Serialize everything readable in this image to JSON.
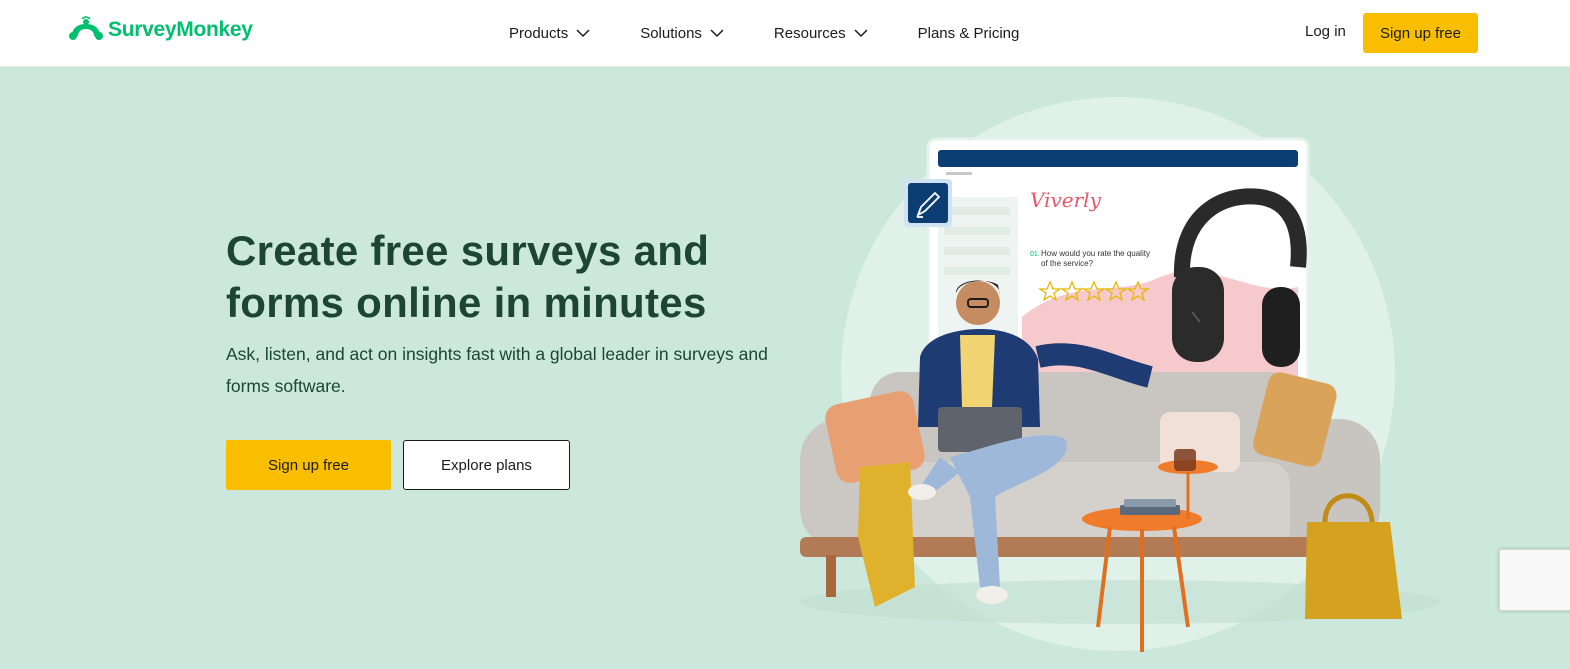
{
  "brand": {
    "name": "SurveyMonkey",
    "accent": "#00bf6f"
  },
  "nav": {
    "items": [
      {
        "label": "Products",
        "has_dropdown": true
      },
      {
        "label": "Solutions",
        "has_dropdown": true
      },
      {
        "label": "Resources",
        "has_dropdown": true
      },
      {
        "label": "Plans & Pricing",
        "has_dropdown": false
      }
    ],
    "login": "Log in",
    "signup": "Sign up free"
  },
  "hero": {
    "headline": "Create free surveys and forms online in minutes",
    "subtitle": "Ask, listen, and act on insights fast with a global leader in surveys and forms software.",
    "primary_cta": "Sign up free",
    "secondary_cta": "Explore plans",
    "background": "#cce8dc",
    "cta_color": "#f9be00"
  },
  "illustration": {
    "survey_brand": "Viverly",
    "question_number": "01.",
    "question_line1": "How would you rate the quality",
    "question_line2": "of the service?",
    "star_count": 5,
    "icons": [
      "pen-icon",
      "headphones-icon",
      "stars-rating-icon"
    ]
  }
}
